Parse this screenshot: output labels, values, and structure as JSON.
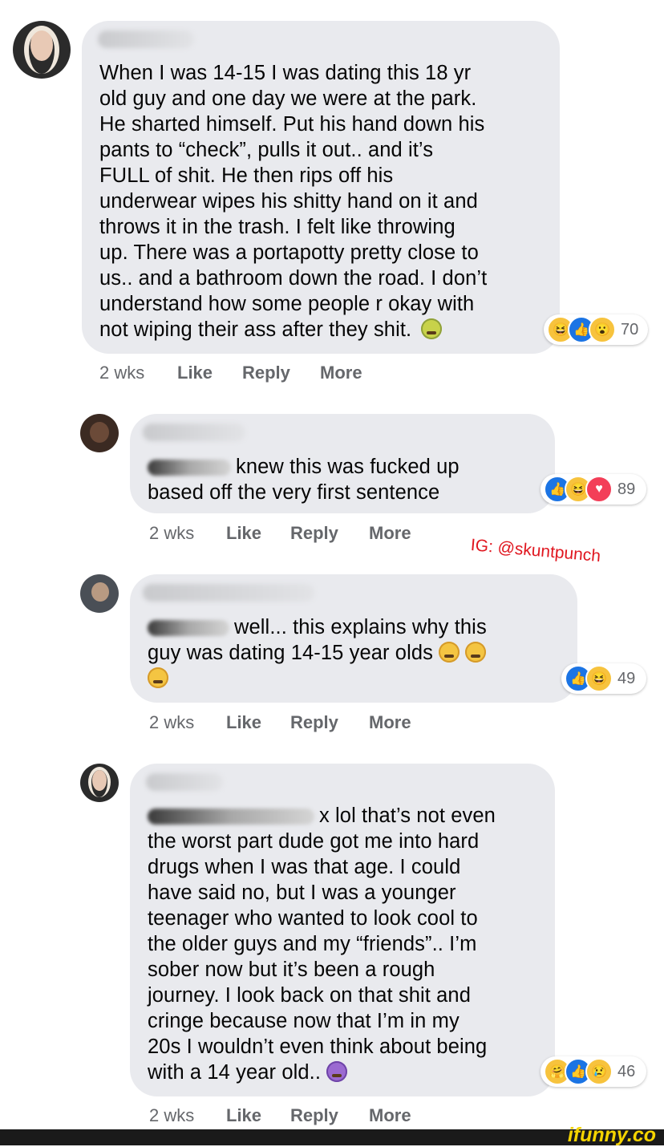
{
  "comments": [
    {
      "text": "When I was 14-15 I was dating this 18 yr\nold guy and one day we were at the park.\nHe sharted himself. Put his hand down his\npants to “check”, pulls it out.. and it’s\nFULL of shit. He then rips off his\nunderwear wipes his shitty hand on it and\nthrows it in the trash. I felt like throwing\nup. There was a portapotty pretty close to\nus.. and a bathroom down the road. I don’t\nunderstand how some people r okay with\nnot wiping their ass after they shit.",
      "emoji": "nauseated-face",
      "time": "2 wks",
      "like": "Like",
      "reply": "Reply",
      "more": "More",
      "reactions": [
        "laugh",
        "like",
        "wow"
      ],
      "reaction_count": "70"
    },
    {
      "text_line1": "knew this was fucked up",
      "text_line2": "based off the very first sentence",
      "time": "2 wks",
      "like": "Like",
      "reply": "Reply",
      "more": "More",
      "reactions": [
        "like",
        "laugh",
        "love"
      ],
      "reaction_count": "89"
    },
    {
      "text_line1": "well... this explains why this",
      "text_line2": "guy was dating 14-15 year olds",
      "emoji": "woozy-face",
      "time": "2 wks",
      "like": "Like",
      "reply": "Reply",
      "more": "More",
      "reactions": [
        "like",
        "laugh"
      ],
      "reaction_count": "49"
    },
    {
      "text_line1": "x lol that’s not even",
      "text_rest": "the worst part dude got me into hard\ndrugs when I was that age. I could\nhave said no, but I was a younger\nteenager who wanted to look cool to\nthe older guys and my “friends”.. I’m\nsober now but it’s been a rough\njourney. I look back on that shit and\ncringe because now that I’m in my\n20s I wouldn’t even think about being\nwith a 14 year old..",
      "emoji": "dizzy-face",
      "time": "2 wks",
      "like": "Like",
      "reply": "Reply",
      "more": "More",
      "reactions": [
        "care",
        "like",
        "sad"
      ],
      "reaction_count": "46"
    }
  ],
  "watermark": "IG: @skuntpunch",
  "site_logo": "ifunny.co",
  "colors": {
    "bubble": "#e9eaee",
    "meta_text": "#65676b",
    "like_blue": "#1b74e4",
    "watermark_red": "#e0161f"
  }
}
